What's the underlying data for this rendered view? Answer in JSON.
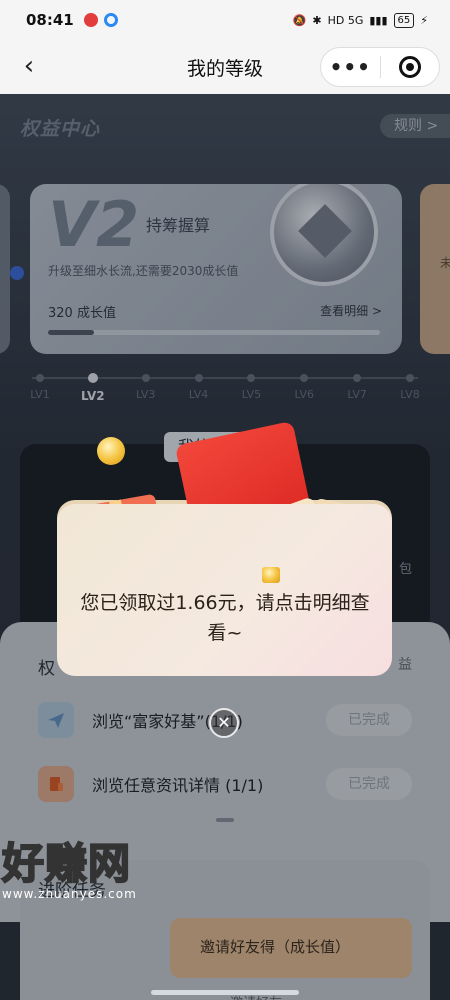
{
  "status_bar": {
    "time": "08:41",
    "network": "HD 5G",
    "battery": "65"
  },
  "nav": {
    "title": "我的等级",
    "more": "•••"
  },
  "rights_center": {
    "title": "权益中心",
    "rules": "规则 >"
  },
  "level_card": {
    "level": "V2",
    "subtitle": "持筹握算",
    "description": "升级至细水长流,还需要2030成长值",
    "growth_value": "320  成长值",
    "detail_link": "查看明细 >",
    "progress": 0.14
  },
  "side_card_right_text": "未",
  "levels": [
    "LV1",
    "LV2",
    "LV3",
    "LV4",
    "LV5",
    "LV6",
    "LV7",
    "LV8"
  ],
  "active_level_index": 1,
  "my_level_tab": "我的等级",
  "right_partial_text": "包",
  "sheet": {
    "title": "权",
    "right": "益",
    "tasks": [
      {
        "label": "浏览“富家好基”(1/1)",
        "button": "已完成"
      },
      {
        "label": "浏览任意资讯详情 (1/1)",
        "button": "已完成"
      }
    ]
  },
  "advanced": {
    "title": "进阶任务",
    "invite": "邀请好友得（成长值）",
    "invite_sub": "邀请好友"
  },
  "popup": {
    "message": "您已领取过1.66元，请点击明细查看~"
  },
  "watermark": {
    "logo": "好赚网",
    "url": "www.zhuanyes.com"
  }
}
